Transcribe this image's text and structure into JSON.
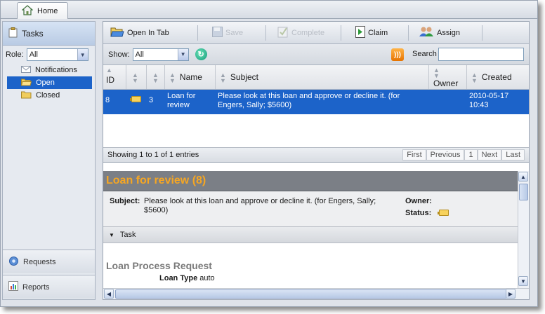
{
  "tabs": [
    {
      "label": "Home",
      "icon": "house-icon"
    }
  ],
  "sidebar": {
    "header": "Tasks",
    "role_label": "Role:",
    "role_value": "All",
    "tree": [
      {
        "label": "Notifications",
        "icon": "envelope-icon",
        "selected": false
      },
      {
        "label": "Open",
        "icon": "folder-open-icon",
        "selected": true
      },
      {
        "label": "Closed",
        "icon": "folder-icon",
        "selected": false
      }
    ],
    "requests_label": "Requests",
    "reports_label": "Reports"
  },
  "toolbar": {
    "open_in_tab": "Open In Tab",
    "save": "Save",
    "complete": "Complete",
    "claim": "Claim",
    "assign": "Assign"
  },
  "filter": {
    "show_label": "Show:",
    "show_value": "All",
    "search_label": "Search",
    "search_value": ""
  },
  "grid": {
    "columns": [
      "ID",
      "",
      "",
      "Name",
      "Subject",
      "Owner",
      "Created"
    ],
    "rows": [
      {
        "id": "8",
        "flag": "flag-icon",
        "count": "3",
        "name": "Loan for review",
        "subject": "Please look at this loan and approve or decline it. (for Engers, Sally; $5600)",
        "owner": "",
        "created": "2010-05-17 10:43"
      }
    ],
    "summary": "Showing 1 to 1 of 1 entries",
    "pager": [
      "First",
      "Previous",
      "1",
      "Next",
      "Last"
    ]
  },
  "detail": {
    "title": "Loan for review (8)",
    "subject_label": "Subject:",
    "subject_value": "Please look at this loan and approve or decline it. (for Engers, Sally; $5600)",
    "owner_label": "Owner:",
    "owner_value": "",
    "status_label": "Status:",
    "task_section": "Task",
    "form_title": "Loan Process Request",
    "loan_type_label": "Loan Type",
    "loan_type_value": "auto"
  },
  "colors": {
    "selection": "#1c63c9",
    "title_text": "#f5a623",
    "title_bg": "#7b7f86"
  }
}
